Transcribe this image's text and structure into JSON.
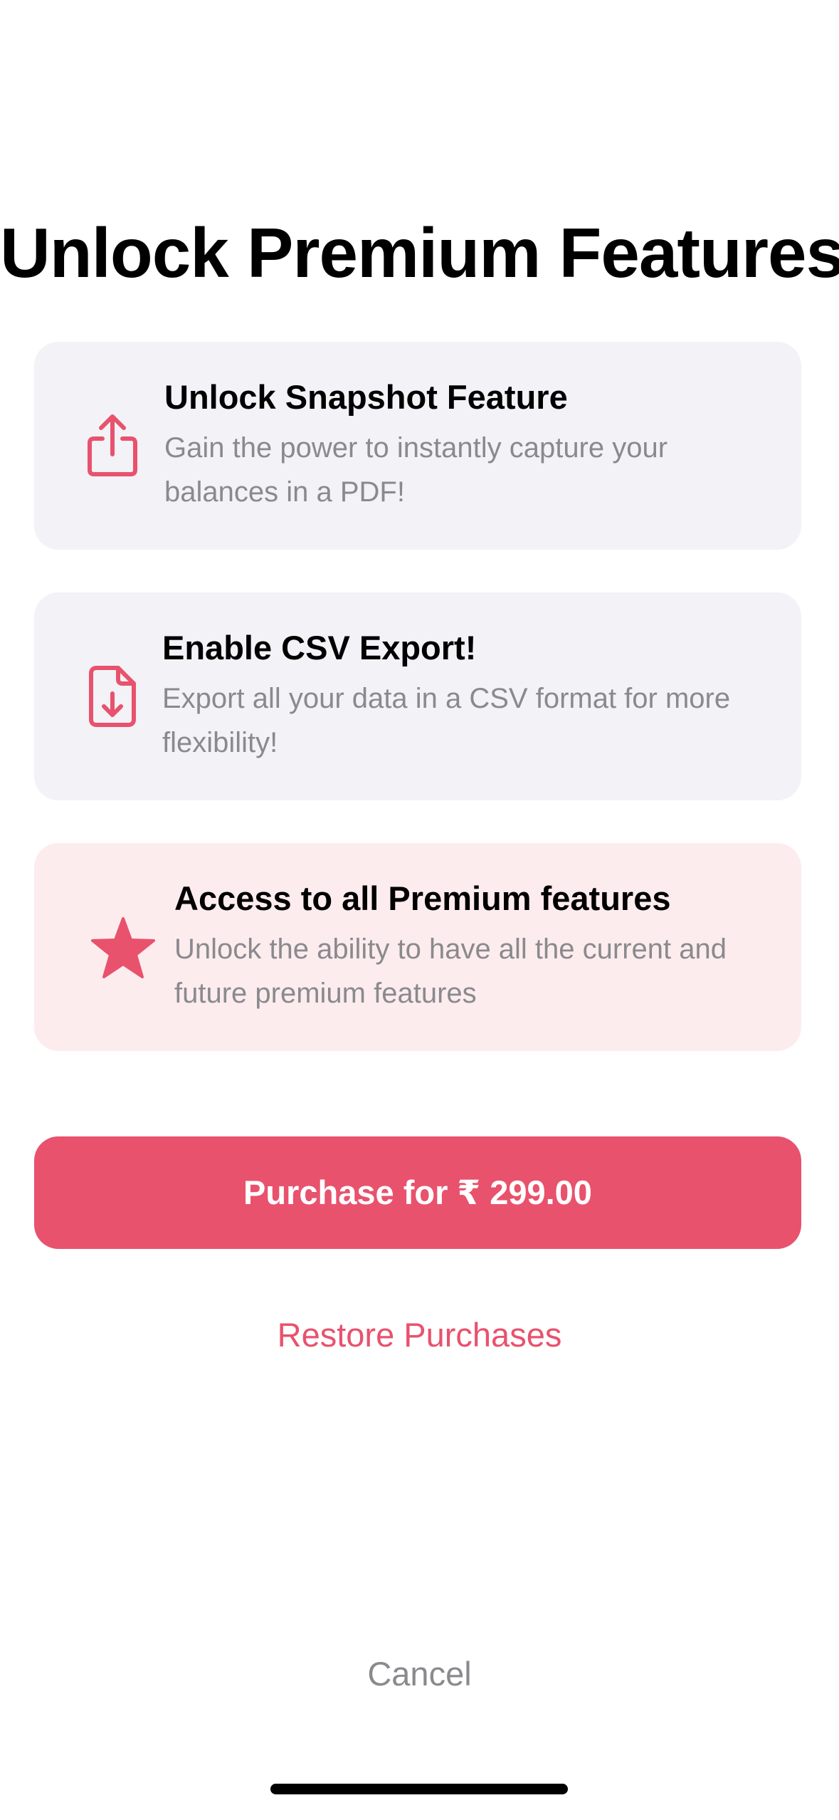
{
  "title": "Unlock Premium Features",
  "features": [
    {
      "icon": "share-icon",
      "title": "Unlock Snapshot Feature",
      "description": "Gain the power to instantly capture your balances in a PDF!"
    },
    {
      "icon": "document-download-icon",
      "title": "Enable CSV Export!",
      "description": "Export all your data in a CSV format for more flexibility!"
    },
    {
      "icon": "star-icon",
      "title": "Access to all Premium features",
      "description": "Unlock the ability to have all the current and future premium features"
    }
  ],
  "purchase_button": "Purchase for ₹ 299.00",
  "restore_link": "Restore Purchases",
  "cancel_link": "Cancel",
  "colors": {
    "accent": "#e8526d",
    "card_background": "#f2f2f7",
    "highlight_card_background": "#fdecee",
    "secondary_text": "#8a8a8e"
  }
}
